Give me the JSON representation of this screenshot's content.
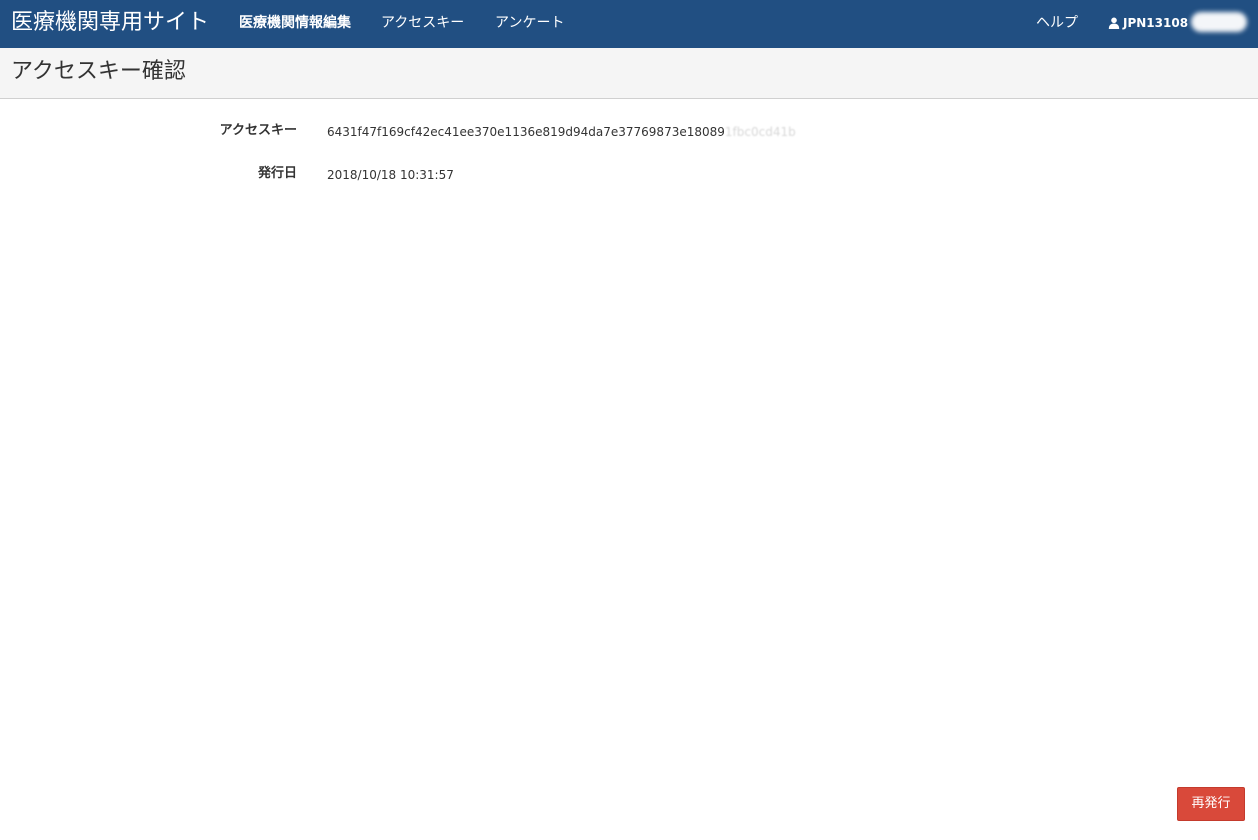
{
  "header": {
    "brand": "医療機関専用サイト",
    "nav": {
      "edit_info": "医療機関情報編集",
      "access_key": "アクセスキー",
      "survey": "アンケート"
    },
    "help": "ヘルプ",
    "user_id": "JPN13108",
    "user_icon": "user-icon"
  },
  "page": {
    "title": "アクセスキー確認"
  },
  "fields": {
    "access_key_label": "アクセスキー",
    "access_key_value": "6431f47f169cf42ec41ee370e1136e819d94da7e37769873e18089",
    "access_key_value_masked": "1fbc0cd41b",
    "issue_date_label": "発行日",
    "issue_date_value": "2018/10/18 10:31:57"
  },
  "actions": {
    "reissue": "再発行"
  },
  "colors": {
    "navbar": "#214f82",
    "title_bar": "#f5f5f5",
    "reissue_button": "#d9493a"
  }
}
